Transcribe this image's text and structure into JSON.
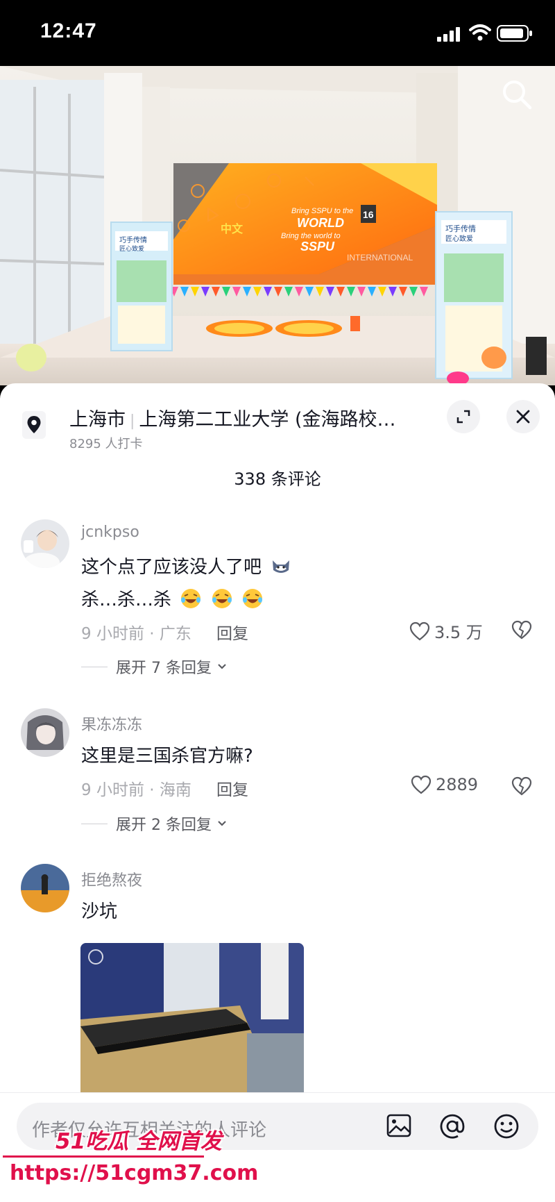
{
  "status_bar": {
    "time": "12:47"
  },
  "icons": {
    "search": "search-icon",
    "location": "location-pin-icon",
    "expand": "expand-icon",
    "close": "close-icon",
    "like": "heart-icon",
    "dislike": "broken-heart-icon",
    "image": "image-icon",
    "mention": "at-icon",
    "emoji": "smiley-icon"
  },
  "location": {
    "city": "上海市",
    "place": "上海第二工业大学 (金海路校…",
    "checkins": "8295 人打卡"
  },
  "comments_header": {
    "count_label": "338 条评论"
  },
  "comments": [
    {
      "user": "jcnkpso",
      "text_line1": "这个点了应该没人了吧",
      "text_line2": "杀…杀…杀",
      "time_place": "9 小时前 · 广东",
      "reply_label": "回复",
      "likes": "3.5 万",
      "expand_label": "展开 7 条回复"
    },
    {
      "user": "果冻冻冻",
      "text_line1": "这里是三国杀官方嘛?",
      "time_place": "9 小时前 · 海南",
      "reply_label": "回复",
      "likes": "2889",
      "expand_label": "展开 2 条回复"
    },
    {
      "user": "拒绝熬夜",
      "text_line1": "沙坑"
    }
  ],
  "input": {
    "placeholder": "作者仅允许互相关注的人评论"
  },
  "watermark": {
    "brand": "51吃瓜 全网首发",
    "url": "https://51cgm37.com"
  },
  "hero": {
    "banner_line1": "Bring SSPU to the",
    "banner_line2": "WORLD",
    "banner_line3": "Bring the world to",
    "banner_line4": "SSPU",
    "banner_small": "中文",
    "international": "INTERNATIONAL",
    "poster_left_title": "巧手传情",
    "poster_left_subtitle": "匠心致爱",
    "poster_right_title": "巧手传情",
    "poster_right_subtitle": "匠心致爱",
    "badge": "16"
  },
  "colors": {
    "accent": "#e0104b",
    "text": "#161823",
    "muted": "#8a8b91"
  }
}
